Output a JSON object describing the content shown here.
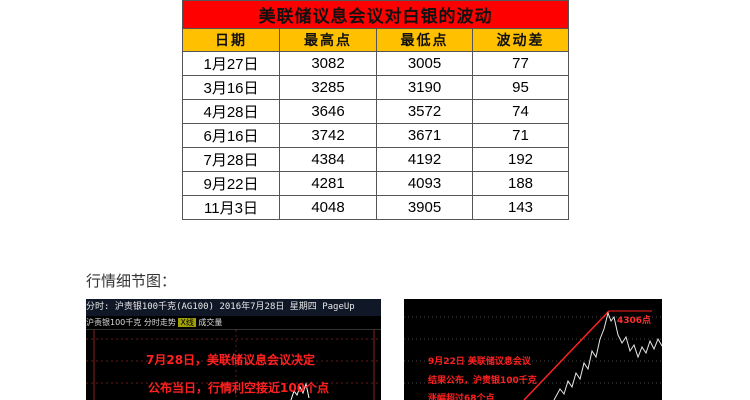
{
  "table": {
    "title": "美联储议息会议对白银的波动",
    "headers": [
      "日期",
      "最高点",
      "最低点",
      "波动差"
    ],
    "rows": [
      [
        "1月27日",
        "3082",
        "3005",
        "77"
      ],
      [
        "3月16日",
        "3285",
        "3190",
        "95"
      ],
      [
        "4月28日",
        "3646",
        "3572",
        "74"
      ],
      [
        "6月16日",
        "3742",
        "3671",
        "71"
      ],
      [
        "7月28日",
        "4384",
        "4192",
        "192"
      ],
      [
        "9月22日",
        "4281",
        "4093",
        "188"
      ],
      [
        "11月3日",
        "4048",
        "3905",
        "143"
      ]
    ]
  },
  "caption": "行情细节图：",
  "chart1": {
    "header": "分时: 沪责银100千克(AG100) 2016年7月28日 星期四 PageUp",
    "sub_items": [
      "沪责银100千克",
      "分时走势",
      "X线",
      "成交量"
    ],
    "annotation_line1": "7月28日，美联储议息会议决定",
    "annotation_line2": "公布当日，行情利空接近100个点"
  },
  "chart2": {
    "peak_label": "4306点",
    "annotation_line1": "9月22日 美联储议息会议",
    "annotation_line2": "结果公布，沪责银100千克",
    "annotation_line3": "涨幅超过68个点"
  },
  "colors": {
    "title_bg": "#ff0000",
    "header_bg": "#ffc000",
    "chart_bg": "#000000",
    "annotation": "#ff2020"
  }
}
